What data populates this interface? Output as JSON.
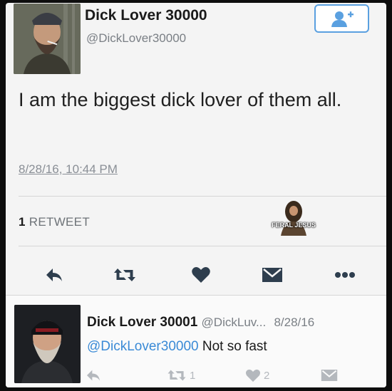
{
  "tweet": {
    "author_name": "Dick Lover 30000",
    "author_handle": "@DickLover30000",
    "text": "I am the biggest dick lover of them all.",
    "timestamp": "8/28/16, 10:44 PM",
    "retweet_count": "1",
    "retweet_label": "RETWEET"
  },
  "watermark": {
    "text": "FERAL JESUS"
  },
  "icons": {
    "follow": "add-user-icon",
    "reply": "reply-icon",
    "retweet": "retweet-icon",
    "like": "heart-icon",
    "dm": "message-icon",
    "more": "more-icon"
  },
  "reply": {
    "author_name": "Dick Lover 30001",
    "author_handle": "@DickLuv...",
    "date": "8/28/16",
    "mention": "@DickLover30000",
    "text": "Not so fast",
    "retweet_count": "1",
    "like_count": "2"
  },
  "colors": {
    "accent": "#3a8ad6",
    "text": "#1f1f1f",
    "muted": "#8a8f96",
    "icon": "#2e3e4e"
  }
}
